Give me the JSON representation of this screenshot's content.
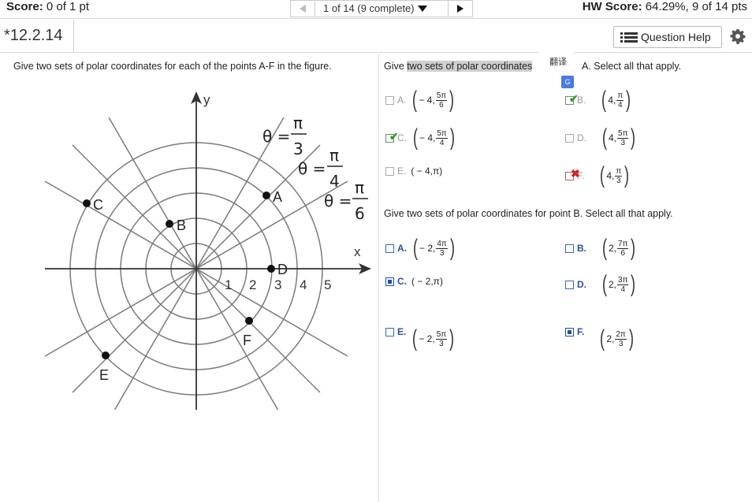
{
  "header": {
    "score_label": "Score:",
    "score_value": "0 of 1 pt",
    "nav_counter": "1 of 14 (9 complete)",
    "hw_label": "HW Score:",
    "hw_value": "64.29%, 9 of 14 pts"
  },
  "question": {
    "number": "*12.2.14",
    "help_label": "Question Help"
  },
  "left": {
    "instruction": "Give two sets of polar coordinates for each of the points A-F in the figure."
  },
  "figure": {
    "axis_x": "x",
    "axis_y": "y",
    "ticks": [
      "1",
      "2",
      "3",
      "4",
      "5"
    ],
    "angle_labels": [
      {
        "theta": "θ =",
        "num": "π",
        "den": "3"
      },
      {
        "theta": "θ =",
        "num": "π",
        "den": "4"
      },
      {
        "theta": "θ =",
        "num": "π",
        "den": "6"
      }
    ],
    "points": [
      "A",
      "B",
      "C",
      "D",
      "E",
      "F"
    ]
  },
  "part_a": {
    "instruction_pre": "Give",
    "instruction_highlight": "two sets of polar coordinates",
    "instruction_post": "A. Select all that apply.",
    "translate_label": "翻译",
    "translate_badge": "G",
    "options": [
      {
        "letter": "A.",
        "pre": "− 4,",
        "num": "5π",
        "den": "6",
        "state": "unchecked"
      },
      {
        "letter": "B.",
        "pre": "4,",
        "num": "π",
        "den": "4",
        "state": "checked-correct"
      },
      {
        "letter": "C.",
        "pre": "− 4,",
        "num": "5π",
        "den": "4",
        "state": "checked-correct"
      },
      {
        "letter": "D.",
        "pre": "4,",
        "num": "5π",
        "den": "3",
        "state": "unchecked"
      },
      {
        "letter": "E.",
        "text": "( − 4,π)",
        "state": "unchecked"
      },
      {
        "letter": "F.",
        "pre": "4,",
        "num": "π",
        "den": "3",
        "state": "checked-wrong"
      }
    ]
  },
  "part_b": {
    "instruction": "Give two sets of polar coordinates for point B. Select all that apply.",
    "options": [
      {
        "letter": "A.",
        "pre": "− 2,",
        "num": "4π",
        "den": "3",
        "state": "unchecked"
      },
      {
        "letter": "B.",
        "pre": "2,",
        "num": "7π",
        "den": "6",
        "state": "unchecked"
      },
      {
        "letter": "C.",
        "text": "( − 2,π)",
        "state": "checked"
      },
      {
        "letter": "D.",
        "pre": "2,",
        "num": "3π",
        "den": "4",
        "state": "unchecked"
      },
      {
        "letter": "E.",
        "pre": "− 2,",
        "num": "5π",
        "den": "3",
        "state": "unchecked"
      },
      {
        "letter": "F.",
        "pre": "2,",
        "num": "2π",
        "den": "3",
        "state": "checked"
      }
    ]
  }
}
